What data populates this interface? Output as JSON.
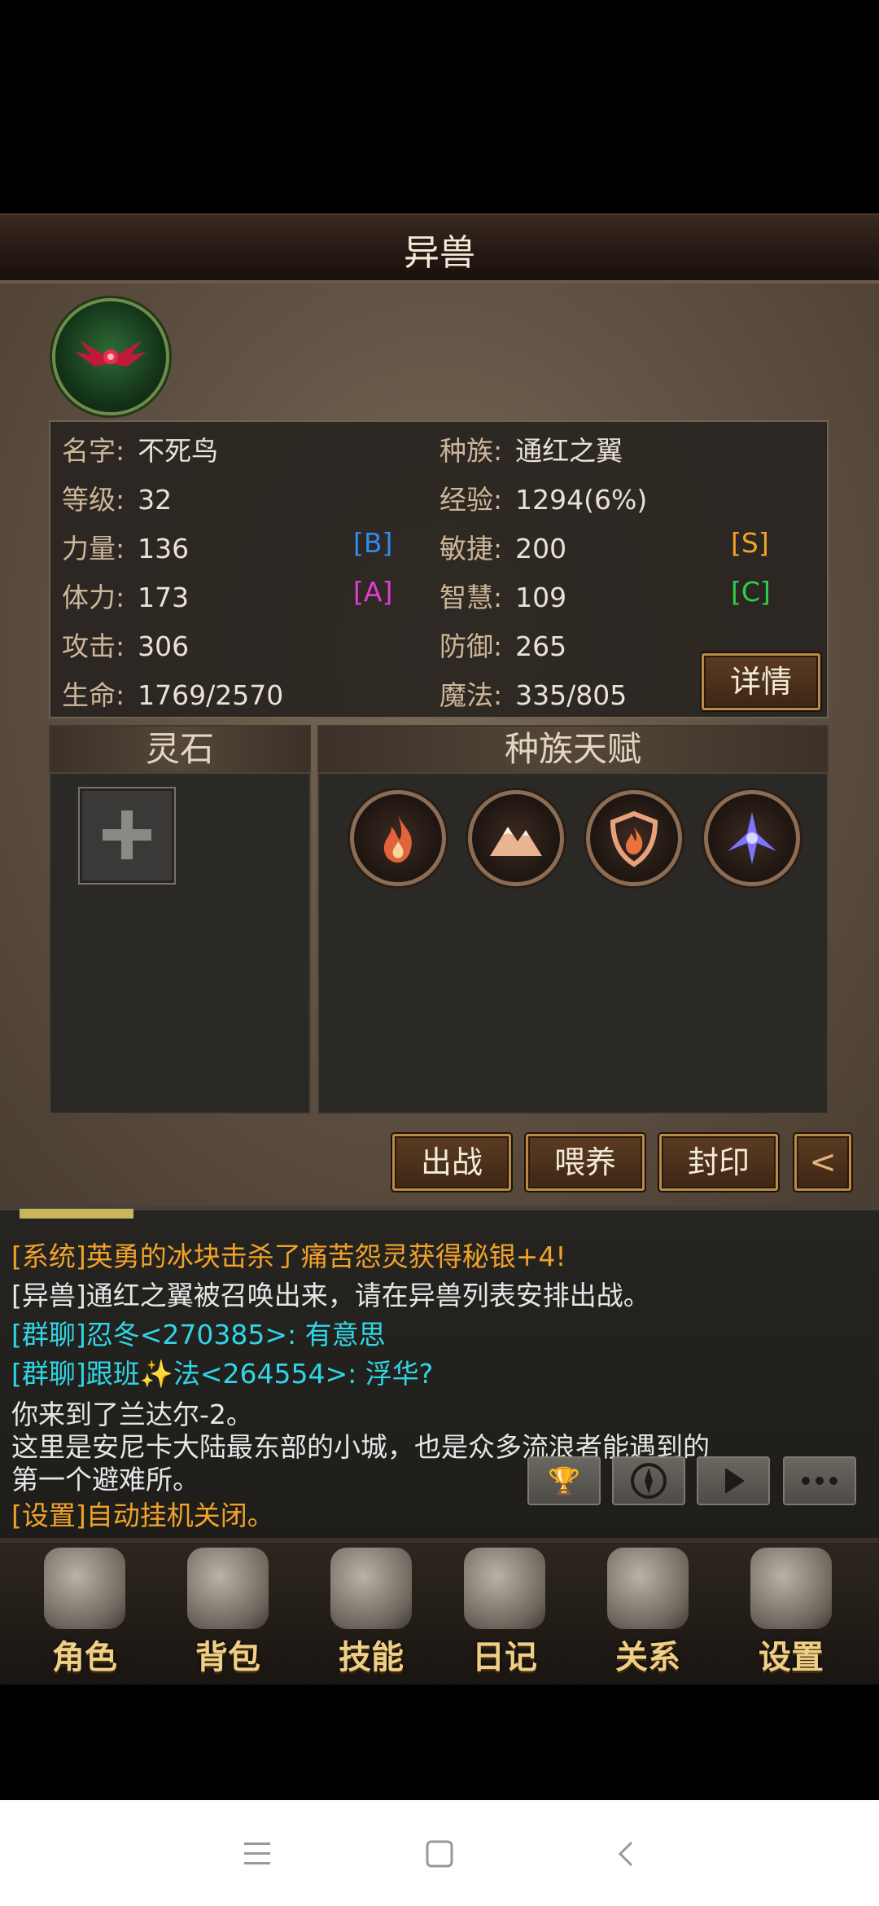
{
  "title": "异兽",
  "pet": {
    "stats": [
      {
        "label": "名字:",
        "value": "不死鸟"
      },
      {
        "label": "种族:",
        "value": "通红之翼"
      },
      {
        "label": "等级:",
        "value": "32"
      },
      {
        "label": "经验:",
        "value": "1294(6%)"
      },
      {
        "label": "力量:",
        "value": "136",
        "grade": "[B]"
      },
      {
        "label": "敏捷:",
        "value": "200",
        "grade": "[S]"
      },
      {
        "label": "体力:",
        "value": "173",
        "grade": "[A]"
      },
      {
        "label": "智慧:",
        "value": "109",
        "grade": "[C]"
      },
      {
        "label": "攻击:",
        "value": "306"
      },
      {
        "label": "防御:",
        "value": "265"
      },
      {
        "label": "生命:",
        "value": "1769/2570"
      },
      {
        "label": "魔法:",
        "value": "335/805"
      }
    ],
    "detail_button": "详情"
  },
  "sections": {
    "spirit_stone": "灵石",
    "race_talent": "种族天赋"
  },
  "talents": [
    {
      "icon": "fire-icon"
    },
    {
      "icon": "mountain-icon"
    },
    {
      "icon": "fire-shield-icon"
    },
    {
      "icon": "wing-burst-icon"
    }
  ],
  "actions": {
    "battle": "出战",
    "feed": "喂养",
    "seal": "封印",
    "back": "<"
  },
  "chat": [
    {
      "text": "[系统]英勇的冰块击杀了痛苦怨灵获得秘银+4!",
      "color": "#f1a229"
    },
    {
      "text": "[异兽]通红之翼被召唤出来，请在异兽列表安排出战。",
      "color": "#e6e6e6"
    },
    {
      "text": "[群聊]忍冬<270385>: 有意思",
      "color": "#2fd6e6"
    },
    {
      "text": "[群聊]跟班✨法<264554>: 浮华?",
      "color": "#2fd6e6"
    },
    {
      "text": "你来到了兰达尔-2。",
      "color": "#e6e6e6"
    },
    {
      "text": "这里是安尼卡大陆最东部的小城，也是众多流浪者能遇到的",
      "color": "#e6e6e6"
    },
    {
      "text": "第一个避难所。",
      "color": "#e6e6e6"
    },
    {
      "text": "[设置]自动挂机关闭。",
      "color": "#f1a229"
    }
  ],
  "chat_icons": [
    "trophy-icon",
    "compass-icon",
    "play-icon",
    "chat-bubble-icon"
  ],
  "nav": [
    {
      "label": "角色",
      "icon": "helmet-icon"
    },
    {
      "label": "背包",
      "icon": "backpack-icon"
    },
    {
      "label": "技能",
      "icon": "skill-book-icon"
    },
    {
      "label": "日记",
      "icon": "scroll-icon"
    },
    {
      "label": "关系",
      "icon": "handshake-icon"
    },
    {
      "label": "设置",
      "icon": "gear-icon"
    }
  ],
  "system_nav": [
    "menu-icon",
    "home-icon",
    "back-icon"
  ]
}
